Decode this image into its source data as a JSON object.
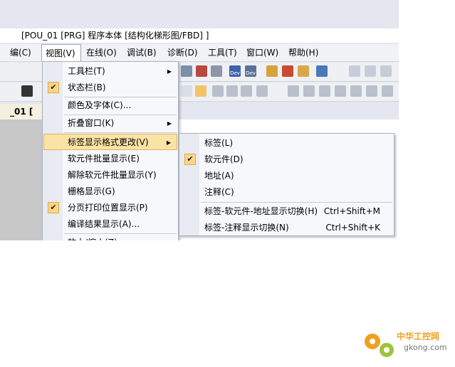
{
  "window": {
    "title": "[POU_01 [PRG] 程序本体 [结构化梯形图/FBD] ]"
  },
  "menubar": {
    "items": [
      "编(C)",
      "视图(V)",
      "在线(O)",
      "调试(B)",
      "诊断(D)",
      "工具(T)",
      "窗口(W)",
      "帮助(H)"
    ]
  },
  "toolbar": {
    "dev_label_1": "Dev",
    "dev_label_2": "Dev"
  },
  "editor": {
    "tab_label": "_01 ["
  },
  "view_menu": {
    "items": [
      {
        "label": "工具栏(T)",
        "checked": false,
        "submenu": true
      },
      {
        "label": "状态栏(B)",
        "checked": true,
        "submenu": false
      },
      {
        "label": "颜色及字体(C)...",
        "checked": false,
        "submenu": false
      },
      {
        "label": "折叠窗口(K)",
        "checked": false,
        "submenu": true
      },
      {
        "label": "标签显示格式更改(V)",
        "checked": false,
        "submenu": true,
        "highlighted": true
      },
      {
        "label": "软元件批量显示(E)",
        "checked": false,
        "submenu": false
      },
      {
        "label": "解除软元件批量显示(Y)",
        "checked": false,
        "submenu": false
      },
      {
        "label": "栅格显示(G)",
        "checked": false,
        "submenu": false
      },
      {
        "label": "分页打印位置显示(P)",
        "checked": true,
        "submenu": false
      },
      {
        "label": "编译结果显示(A)...",
        "checked": false,
        "submenu": false
      },
      {
        "label": "放大/缩小(Z)",
        "checked": false,
        "submenu": true
      }
    ]
  },
  "label_format_submenu": {
    "items": [
      {
        "label": "标签(L)",
        "checked": false,
        "shortcut": ""
      },
      {
        "label": "软元件(D)",
        "checked": true,
        "shortcut": ""
      },
      {
        "label": "地址(A)",
        "checked": false,
        "shortcut": ""
      },
      {
        "label": "注释(C)",
        "checked": false,
        "shortcut": ""
      },
      {
        "label": "标签-软元件-地址显示切换(H)",
        "checked": false,
        "shortcut": "Ctrl+Shift+M"
      },
      {
        "label": "标签-注释显示切换(N)",
        "checked": false,
        "shortcut": "Ctrl+Shift+K"
      }
    ]
  },
  "watermark": {
    "name": "中华工控网",
    "domain": "gkong.com"
  },
  "icons": {
    "check": "checkmark-icon",
    "submenu": "triangle-right-icon"
  },
  "colors": {
    "highlight": "#fbe3a6",
    "check_bg": "#fad58a",
    "menu_bg": "#f7f8fb"
  }
}
